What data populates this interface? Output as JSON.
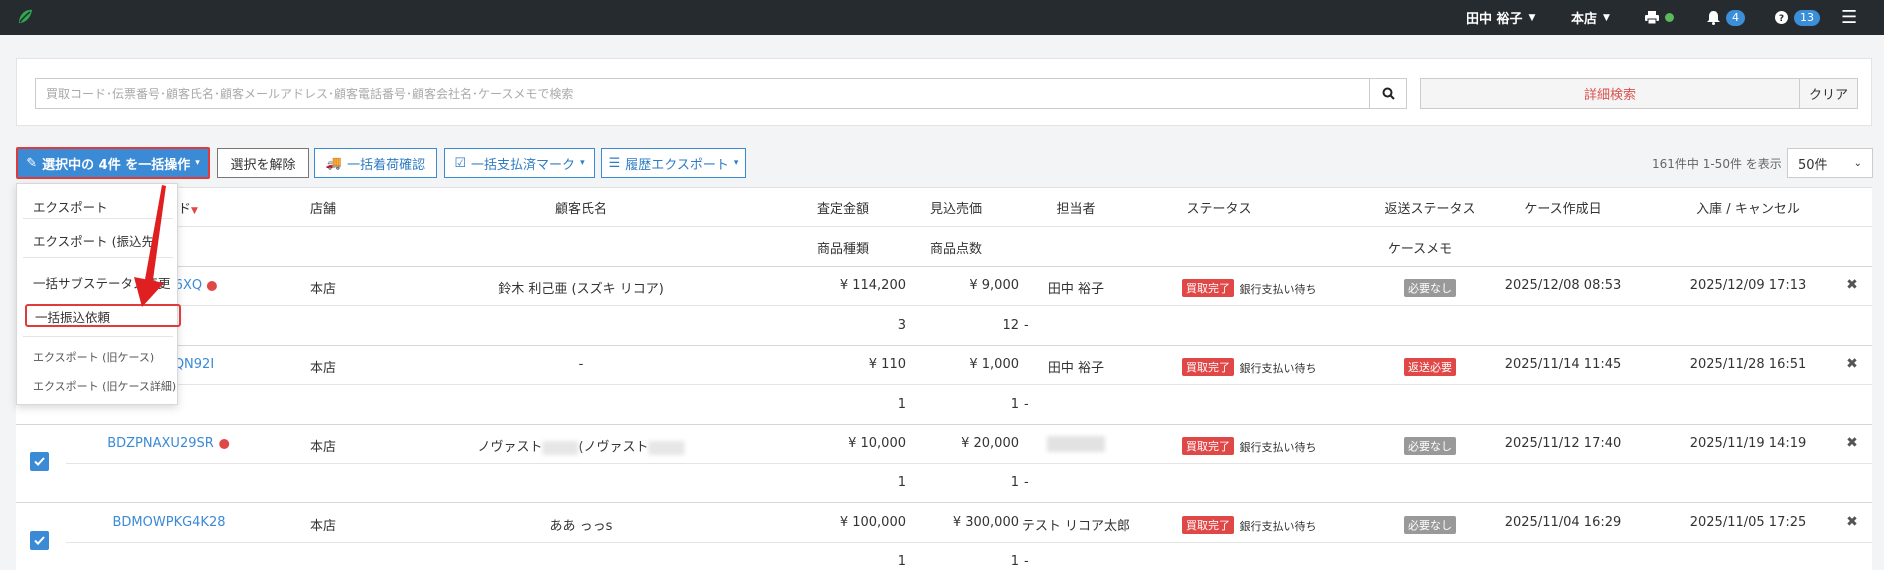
{
  "topbar": {
    "user_name": "田中 裕子",
    "store": "本店",
    "notification_count": "4",
    "help_count": "13"
  },
  "search": {
    "placeholder": "買取コード･伝票番号･顧客氏名･顧客メールアドレス･顧客電話番号･顧客会社名･ケースメモで検索",
    "detail_label": "詳細検索",
    "clear_label": "クリア"
  },
  "toolbar": {
    "bulk_label": "選択中の 4件 を一括操作",
    "deselect_label": "選択を解除",
    "arrival_label": "一括着荷確認",
    "paymark_label": "一括支払済マーク",
    "export_label": "履歴エクスポート",
    "count_text": "161件中 1-50件 を表示",
    "per_page": "50件"
  },
  "dropdown": {
    "items": [
      "エクスポート",
      "エクスポート (振込先)",
      "一括サブステータス変更",
      "一括振込依頼",
      "エクスポート (旧ケース)",
      "エクスポート (旧ケース詳細)"
    ]
  },
  "table": {
    "headers": {
      "code": "ド",
      "store": "店舗",
      "customer": "顧客氏名",
      "assess": "査定金額",
      "sale": "見込売価",
      "staff": "担当者",
      "status": "ステータス",
      "return_status": "返送ステータス",
      "created": "ケース作成日",
      "inout": "入庫 / キャンセル",
      "item_types": "商品種類",
      "item_count": "商品点数",
      "memo": "ケースメモ"
    },
    "rows": [
      {
        "code": "H6XQ",
        "store": "本店",
        "customer": "鈴木 利己亜 (スズキ リコア)",
        "assess": "¥ 114,200",
        "sale": "¥ 9,000",
        "staff": "田中 裕子",
        "status": "買取完了",
        "substatus": "銀行支払い待ち",
        "return": "必要なし",
        "created": "2025/12/08 08:53",
        "inout": "2025/12/09 17:13",
        "types": "3",
        "count": "12",
        "memo": "-"
      },
      {
        "code": "QN92I",
        "store": "本店",
        "customer": "-",
        "assess": "¥ 110",
        "sale": "¥ 1,000",
        "staff": "田中 裕子",
        "status": "買取完了",
        "substatus": "銀行支払い待ち",
        "return": "返送必要",
        "created": "2025/11/14 11:45",
        "inout": "2025/11/28 16:51",
        "types": "1",
        "count": "1",
        "memo": "-"
      },
      {
        "code": "BDZPNAXU29SR",
        "store": "本店",
        "customer_a": "ノヴァスト",
        "customer_b": "(ノヴァスト",
        "assess": "¥ 10,000",
        "sale": "¥ 20,000",
        "staff": "",
        "status": "買取完了",
        "substatus": "銀行支払い待ち",
        "return": "必要なし",
        "created": "2025/11/12 17:40",
        "inout": "2025/11/19 14:19",
        "types": "1",
        "count": "1",
        "memo": "-"
      },
      {
        "code": "BDMOWPKG4K28",
        "store": "本店",
        "customer": "ああ っっs",
        "assess": "¥ 100,000",
        "sale": "¥ 300,000",
        "staff": "テスト リコア太郎",
        "status": "買取完了",
        "substatus": "銀行支払い待ち",
        "return": "必要なし",
        "created": "2025/11/04 16:29",
        "inout": "2025/11/05 17:25",
        "types": "1",
        "count": "1",
        "memo": "-"
      }
    ]
  }
}
